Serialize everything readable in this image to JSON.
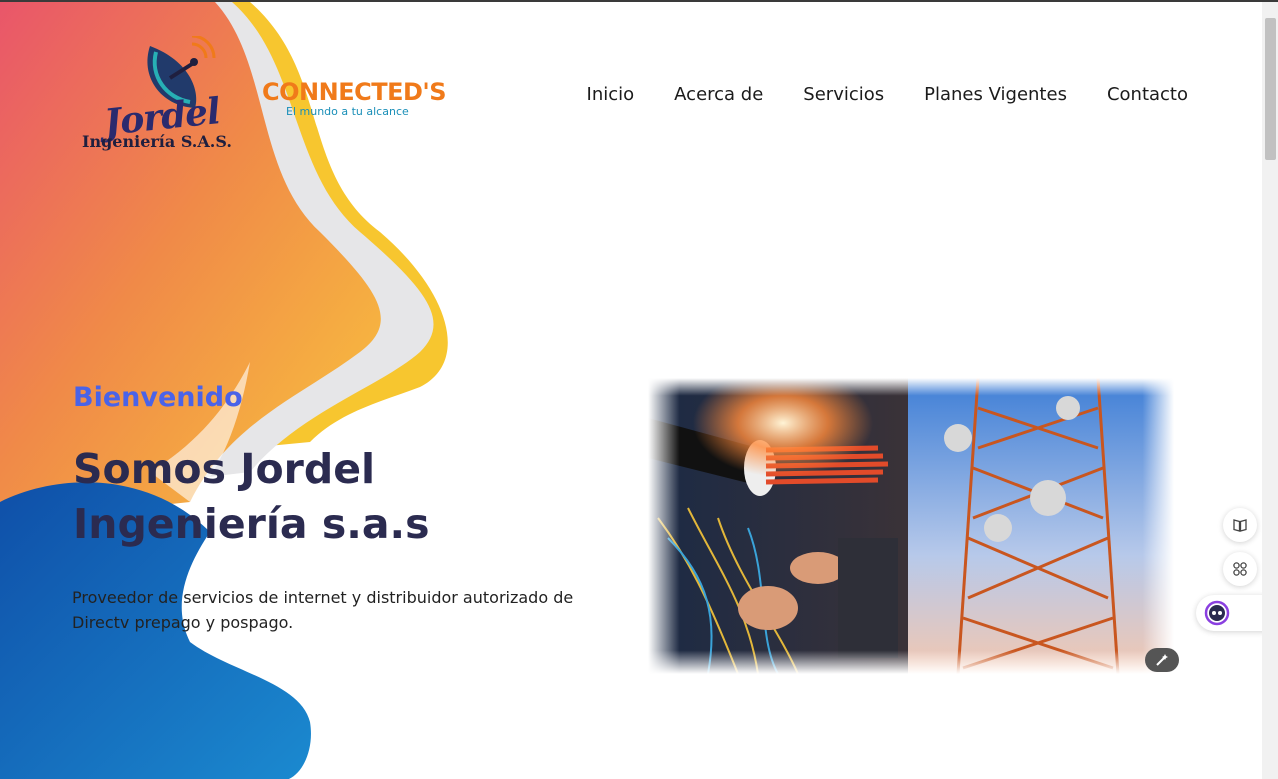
{
  "brand": {
    "jordel_script": "Jordel",
    "jordel_sub": "Ingeniería S.A.S.",
    "connected_name": "CONNECTED'S",
    "connected_tagline": "El mundo a tu alcance"
  },
  "nav": {
    "items": [
      "Inicio",
      "Acerca de",
      "Servicios",
      "Planes Vigentes",
      "Contacto"
    ]
  },
  "hero": {
    "kicker": "Bienvenido",
    "title": "Somos Jordel Ingeniería s.a.s",
    "description": "Proveedor de servicios de internet y distribuidor autorizado de Directv prepago y pospago."
  },
  "colors": {
    "kicker": "#4a63e8",
    "title": "#2b2b50",
    "orange": "#f07a1a",
    "teal": "#1a8fb8",
    "blue": "#1e6fc4"
  },
  "icons": {
    "edit_image": "magic-wand-icon",
    "reader": "book-open-icon",
    "apps": "apps-grid-icon",
    "assistant": "assistant-face-icon"
  }
}
